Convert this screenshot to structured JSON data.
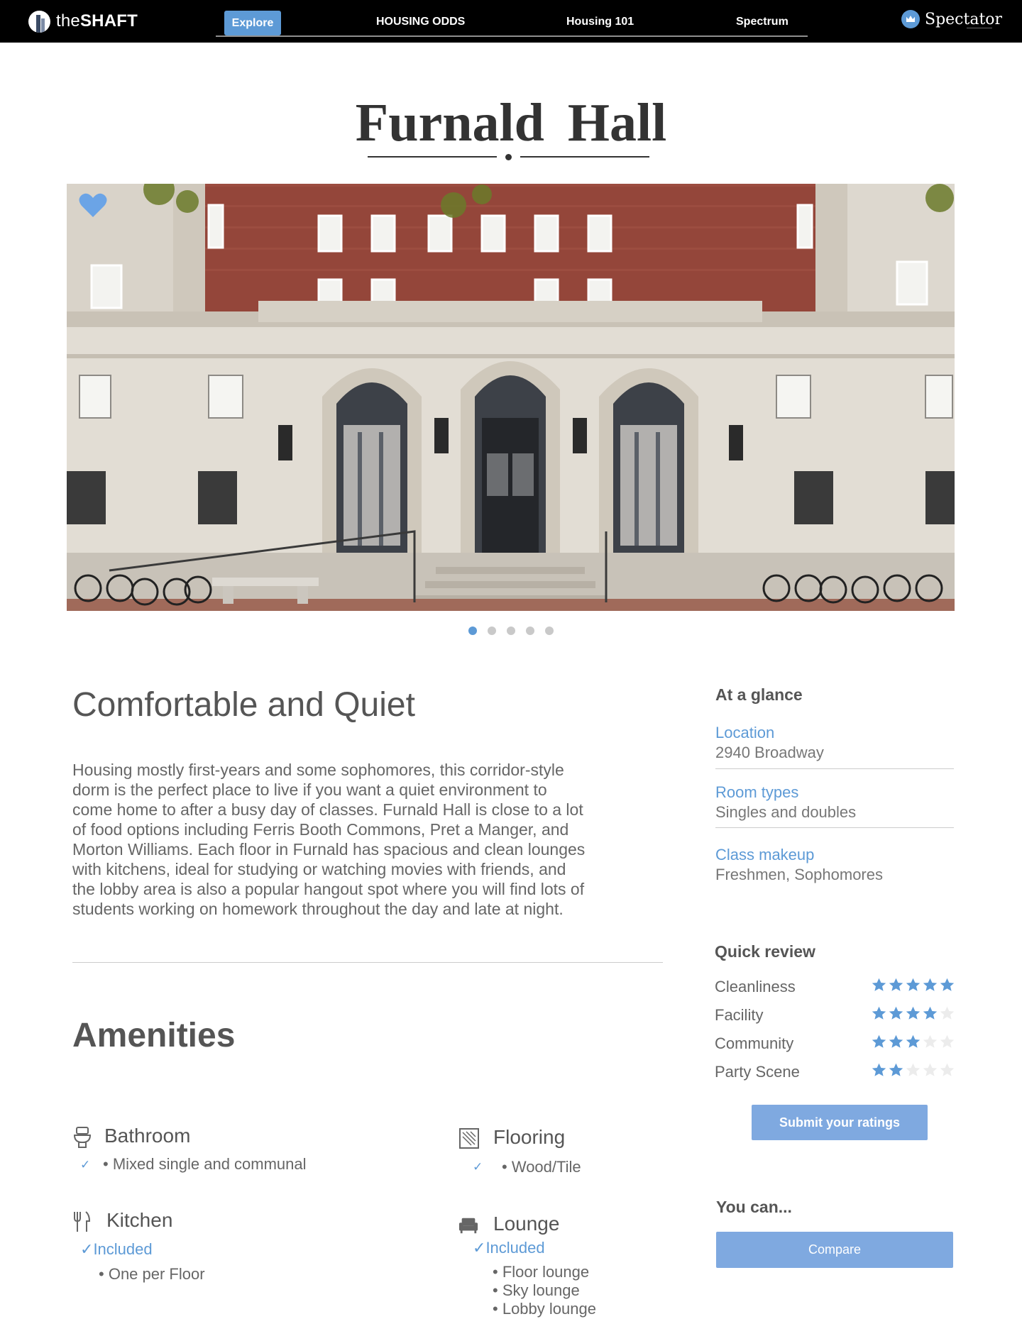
{
  "brand": {
    "logo_prefix": "the",
    "logo_bold": "SHAFT",
    "partner": "Spectator"
  },
  "nav": {
    "items": [
      "Explore",
      "HOUSING ODDS",
      "Housing 101",
      "Spectrum"
    ],
    "active": "Explore"
  },
  "colors": {
    "accent": "#5d9ad6",
    "button": "#7fa9e0",
    "topbar": "#000000"
  },
  "page": {
    "title": "Furnald Hall"
  },
  "hero": {
    "slide_count": 5,
    "active_slide": 1,
    "favorite_icon": "heart-icon"
  },
  "intro": {
    "headline": "Comfortable and Quiet",
    "lines": [
      "Housing mostly first-years and some sophomores, this corridor-style",
      "dorm is the perfect place to live if you want a quiet environment to",
      "come home to after a busy day of classes. Furnald Hall is close to a lot",
      "of food options including Ferris Booth Commons, Pret a Manger, and",
      "Morton Williams. Each floor in Furnald has spacious and clean lounges",
      "with kitchens, ideal for studying or watching movies with friends, and",
      "the lobby area is also a popular hangout spot where you will find lots of",
      "students working on homework throughout the day and late at night."
    ]
  },
  "amenities": {
    "title": "Amenities",
    "bathroom": {
      "label": "Bathroom",
      "icon": "toilet-icon",
      "items": [
        "Mixed single and communal"
      ]
    },
    "flooring": {
      "label": "Flooring",
      "icon": "flooring-icon",
      "items": [
        "Wood/Tile"
      ]
    },
    "kitchen": {
      "label": "Kitchen",
      "icon": "utensils-icon",
      "status": "Included",
      "items": [
        "One per Floor"
      ]
    },
    "lounge": {
      "label": "Lounge",
      "icon": "sofa-icon",
      "status": "Included",
      "items": [
        "Floor lounge",
        "Sky lounge",
        "Lobby lounge"
      ]
    }
  },
  "glance": {
    "title": "At a glance",
    "location": {
      "label": "Location",
      "value": "2940 Broadway"
    },
    "room_types": {
      "label": "Room types",
      "value": "Singles and doubles"
    },
    "class_makeup": {
      "label": "Class makeup",
      "value": "Freshmen, Sophomores"
    }
  },
  "review": {
    "title": "Quick review",
    "max": 5,
    "ratings": [
      {
        "label": "Cleanliness",
        "stars": 5
      },
      {
        "label": "Facility",
        "stars": 4
      },
      {
        "label": "Community",
        "stars": 3
      },
      {
        "label": "Party Scene",
        "stars": 2
      }
    ],
    "submit_label": "Submit your ratings"
  },
  "actions": {
    "title": "You can...",
    "compare_label": "Compare"
  }
}
